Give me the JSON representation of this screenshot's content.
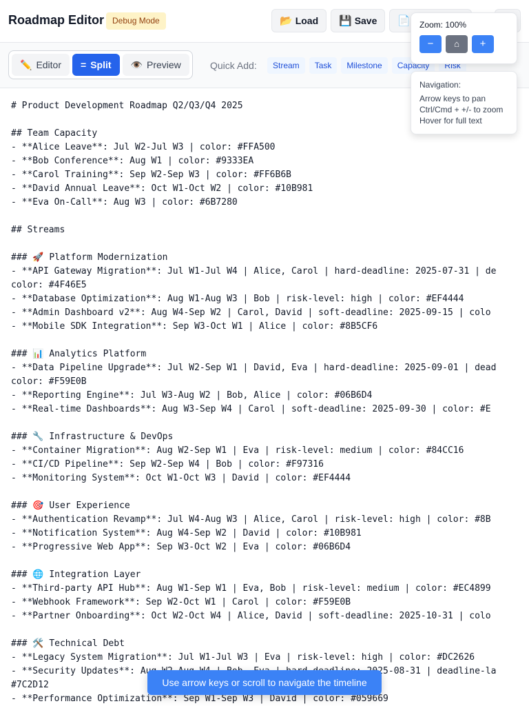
{
  "header": {
    "title": "Roadmap Editor",
    "badge": "Debug Mode",
    "load_label": "Load",
    "save_label": "Save",
    "load_icon": "📂",
    "save_icon": "💾",
    "export_icon": "📄"
  },
  "toolbar": {
    "modes": [
      {
        "icon": "✏️",
        "label": "Editor"
      },
      {
        "icon": "=",
        "label": "Split"
      },
      {
        "icon": "👁️",
        "label": "Preview"
      }
    ],
    "active_mode": "Split",
    "quick_add_label": "Quick Add:",
    "quick_add_items": [
      "Stream",
      "Task",
      "Milestone",
      "Capacity",
      "Risk"
    ]
  },
  "zoom": {
    "label": "Zoom: 100%",
    "minus": "−",
    "reset": "⌂",
    "plus": "+"
  },
  "navigation": {
    "title": "Navigation:",
    "lines": [
      "Arrow keys to pan",
      "Ctrl/Cmd + +/- to zoom",
      "Hover for full text"
    ]
  },
  "editor": {
    "lines": [
      "# Product Development Roadmap Q2/Q3/Q4 2025",
      "",
      "## Team Capacity",
      "- **Alice Leave**: Jul W2-Jul W3 | color: #FFA500",
      "- **Bob Conference**: Aug W1 | color: #9333EA",
      "- **Carol Training**: Sep W2-Sep W3 | color: #FF6B6B",
      "- **David Annual Leave**: Oct W1-Oct W2 | color: #10B981",
      "- **Eva On-Call**: Aug W3 | color: #6B7280",
      "",
      "## Streams",
      "",
      "### 🚀 Platform Modernization",
      "- **API Gateway Migration**: Jul W1-Jul W4 | Alice, Carol | hard-deadline: 2025-07-31 | de",
      "color: #4F46E5",
      "- **Database Optimization**: Aug W1-Aug W3 | Bob | risk-level: high | color: #EF4444",
      "- **Admin Dashboard v2**: Aug W4-Sep W2 | Carol, David | soft-deadline: 2025-09-15 | colo",
      "- **Mobile SDK Integration**: Sep W3-Oct W1 | Alice | color: #8B5CF6",
      "",
      "### 📊 Analytics Platform",
      "- **Data Pipeline Upgrade**: Jul W2-Sep W1 | David, Eva | hard-deadline: 2025-09-01 | dead",
      "color: #F59E0B",
      "- **Reporting Engine**: Jul W3-Aug W2 | Bob, Alice | color: #06B6D4",
      "- **Real-time Dashboards**: Aug W3-Sep W4 | Carol | soft-deadline: 2025-09-30 | color: #E",
      "",
      "### 🔧 Infrastructure & DevOps",
      "- **Container Migration**: Aug W2-Sep W1 | Eva | risk-level: medium | color: #84CC16",
      "- **CI/CD Pipeline**: Sep W2-Sep W4 | Bob | color: #F97316",
      "- **Monitoring System**: Oct W1-Oct W3 | David | color: #EF4444",
      "",
      "### 🎯 User Experience",
      "- **Authentication Revamp**: Jul W4-Aug W3 | Alice, Carol | risk-level: high | color: #8B",
      "- **Notification System**: Aug W4-Sep W2 | David | color: #10B981",
      "- **Progressive Web App**: Sep W3-Oct W2 | Eva | color: #06B6D4",
      "",
      "### 🌐 Integration Layer",
      "- **Third-party API Hub**: Aug W1-Sep W1 | Eva, Bob | risk-level: medium | color: #EC4899",
      "- **Webhook Framework**: Sep W2-Oct W1 | Carol | color: #F59E0B",
      "- **Partner Onboarding**: Oct W2-Oct W4 | Alice, David | soft-deadline: 2025-10-31 | colo",
      "",
      "### 🛠️ Technical Debt",
      "- **Legacy System Migration**: Jul W1-Jul W3 | Eva | risk-level: high | color: #DC2626",
      "- **Security Updates**: Aug W2-Aug W4 | Bob, Eva | hard-deadline: 2025-08-31 | deadline-la",
      "#7C2D12",
      "- **Performance Optimization**: Sep W1-Sep W3 | David | color: #059669"
    ]
  },
  "toast": "Use arrow keys or scroll to navigate the timeline",
  "colors": {
    "accent": "#2563eb",
    "badge_bg": "#fef3c7",
    "toast_bg": "#3b82f6"
  }
}
